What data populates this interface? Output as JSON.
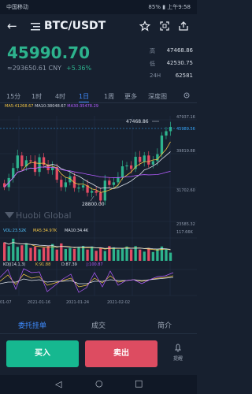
{
  "status": {
    "carrier": "中国移动 ",
    "right": "85% ▮ 上午9:58"
  },
  "header": {
    "pair": "BTC/USDT",
    "back_icon": "back-arrow-icon",
    "market_icon": "menu-bars-icon",
    "favorite_icon": "star-icon",
    "scan_icon": "scan-icon",
    "share_icon": "share-icon"
  },
  "ticker": {
    "price": "45990.70",
    "cny": "≈293650.61 CNY",
    "change": "+5.36%",
    "stats": [
      {
        "key": "高",
        "value": "47468.86"
      },
      {
        "key": "低",
        "value": "42530.75"
      },
      {
        "key": "24H",
        "value": "62581"
      }
    ]
  },
  "periods": [
    {
      "label": "15分",
      "active": false
    },
    {
      "label": "1时",
      "active": false
    },
    {
      "label": "4时",
      "active": false
    },
    {
      "label": "1日",
      "active": true
    },
    {
      "label": "1周",
      "active": false
    },
    {
      "label": "更多",
      "active": false
    },
    {
      "label": "深度图",
      "active": false
    }
  ],
  "chart_indicators": {
    "ma5": "MA5:41268.67",
    "ma10": "MA10:38048.67",
    "ma30": "MA30:35478.29",
    "vol": "VOL:23.52K",
    "vol_ma5": "MA5:34.97K",
    "vol_ma10": "MA10:34.4K",
    "kdj": "KDJ(14,1,3)",
    "k": "K:91.88",
    "d": "D:87.39",
    "j": "J:100.87",
    "watermark": "Huobi Global"
  },
  "chart_data": {
    "type": "candlestick",
    "x_labels": [
      "01-07",
      "2021-01-16",
      "2021-01-24",
      "2021-02-02"
    ],
    "y_labels": [
      "47937.16",
      "45989.56",
      "39819.88",
      "31702.60",
      "23585.32"
    ],
    "high_label": "47468.86",
    "low_label": "28800.00",
    "volume_axis": "117.66K",
    "series": {
      "open": [
        33000,
        32100,
        34200,
        36500,
        39400,
        36900,
        38300,
        38100,
        35600,
        39000,
        37200,
        36000,
        36700,
        33800,
        32100,
        33200,
        34600,
        31900,
        32000,
        32500,
        30800,
        31200,
        30800,
        29000,
        33600,
        32600,
        33200,
        34400,
        36900,
        37100,
        36300,
        39100,
        37900,
        39400,
        37300,
        38100,
        39700,
        44000,
        45000
      ],
      "close": [
        32100,
        34200,
        36500,
        39400,
        36900,
        38300,
        38100,
        35600,
        39000,
        37200,
        36000,
        36700,
        33800,
        32100,
        33200,
        34600,
        31900,
        32000,
        32500,
        30800,
        31200,
        30800,
        29000,
        33600,
        32600,
        33200,
        34400,
        36900,
        37100,
        36300,
        39100,
        37900,
        39400,
        37300,
        38100,
        39700,
        44000,
        45000,
        45990
      ],
      "volume": [
        90,
        72,
        108,
        68,
        76,
        86,
        63,
        69,
        56,
        64,
        72,
        82,
        55,
        85,
        58,
        63,
        58,
        68,
        73,
        55,
        70,
        49,
        65,
        48,
        72,
        66,
        55,
        62,
        70,
        56,
        72,
        55,
        45,
        62,
        43,
        58,
        70,
        56,
        40
      ]
    }
  },
  "bottom_tabs": [
    {
      "label": "委托挂单",
      "active": true
    },
    {
      "label": "成交",
      "active": false
    },
    {
      "label": "简介",
      "active": false
    }
  ],
  "actions": {
    "buy": "买入",
    "sell": "卖出",
    "alert": "提醒",
    "alert_icon": "bell-icon"
  },
  "navbar": {
    "back": "◁",
    "home": "○",
    "recent": "□"
  }
}
